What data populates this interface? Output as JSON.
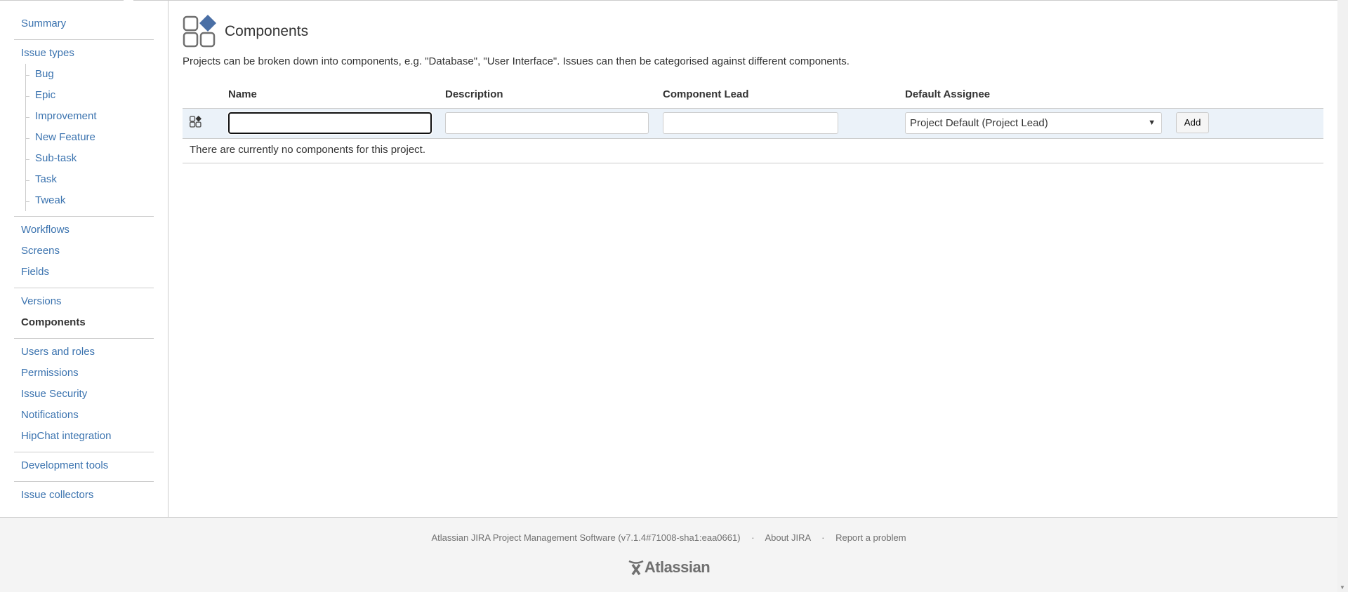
{
  "sidebar": {
    "summary": "Summary",
    "issue_types": "Issue types",
    "issue_type_items": [
      "Bug",
      "Epic",
      "Improvement",
      "New Feature",
      "Sub-task",
      "Task",
      "Tweak"
    ],
    "workflows": "Workflows",
    "screens": "Screens",
    "fields": "Fields",
    "versions": "Versions",
    "components": "Components",
    "users_roles": "Users and roles",
    "permissions": "Permissions",
    "issue_security": "Issue Security",
    "notifications": "Notifications",
    "hipchat": "HipChat integration",
    "dev_tools": "Development tools",
    "issue_collectors": "Issue collectors"
  },
  "main": {
    "title": "Components",
    "description": "Projects can be broken down into components, e.g. \"Database\", \"User Interface\". Issues can then be categorised against different components.",
    "columns": [
      "Name",
      "Description",
      "Component Lead",
      "Default Assignee"
    ],
    "name_value": "",
    "description_value": "",
    "lead_value": "",
    "assignee_selected": "Project Default (Project Lead)",
    "add_label": "Add",
    "empty_message": "There are currently no components for this project.",
    "accent": "#4a6fa5"
  },
  "footer": {
    "version": "Atlassian JIRA Project Management Software (v7.1.4#71008-sha1:eaa0661)",
    "about": "About JIRA",
    "report": "Report a problem",
    "separator": "·",
    "logo": "Atlassian"
  }
}
